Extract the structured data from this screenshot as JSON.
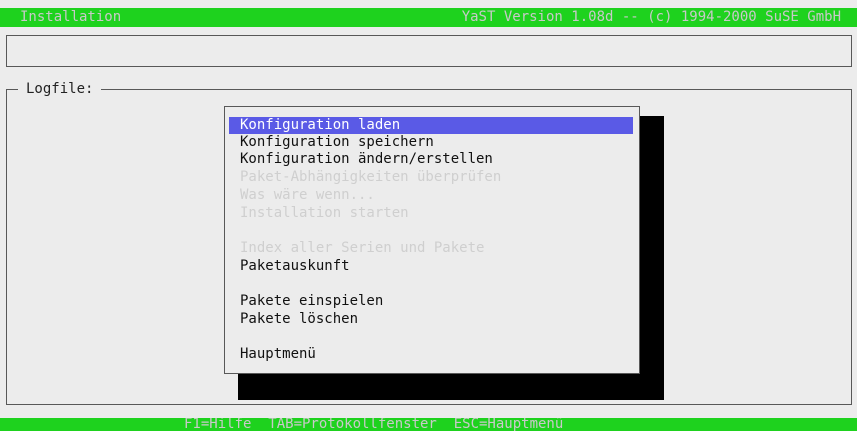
{
  "header": {
    "title": "Installation",
    "version": "YaST Version 1.08d -- (c) 1994-2000 SuSE GmbH"
  },
  "input": {
    "value": ""
  },
  "logfile": {
    "label": "Logfile:"
  },
  "menu": {
    "items": [
      {
        "label": "Konfiguration laden",
        "state": "selected"
      },
      {
        "label": "Konfiguration speichern",
        "state": "enabled"
      },
      {
        "label": "Konfiguration ändern/erstellen",
        "state": "enabled"
      },
      {
        "label": "Paket-Abhängigkeiten überprüfen",
        "state": "disabled"
      },
      {
        "label": "Was wäre wenn...",
        "state": "disabled"
      },
      {
        "label": "Installation starten",
        "state": "disabled"
      },
      {
        "label": "Index aller Serien und Pakete",
        "state": "disabled"
      },
      {
        "label": "Paketauskunft",
        "state": "enabled"
      },
      {
        "label": "Pakete einspielen",
        "state": "enabled"
      },
      {
        "label": "Pakete löschen",
        "state": "enabled"
      },
      {
        "label": "Hauptmenü",
        "state": "enabled"
      }
    ]
  },
  "footer": {
    "hint": "F1=Hilfe  TAB=Protokollfenster  ESC=Hauptmenü"
  },
  "colors": {
    "accent": "#1ed21e",
    "selection": "#5a5ae6",
    "background": "#ececec"
  }
}
